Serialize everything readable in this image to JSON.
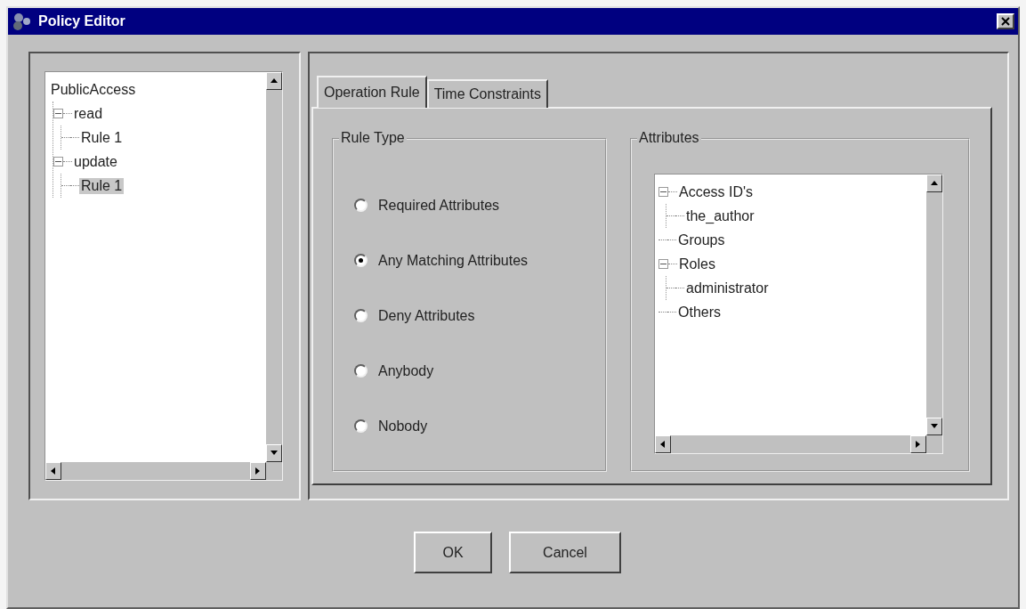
{
  "window": {
    "title": "Policy Editor"
  },
  "policy_tree": [
    {
      "label": "PublicAccess",
      "selected": false,
      "children": [
        {
          "label": "read",
          "selected": false,
          "children": [
            {
              "label": "Rule 1",
              "selected": false
            }
          ]
        },
        {
          "label": "update",
          "selected": false,
          "children": [
            {
              "label": "Rule 1",
              "selected": true
            }
          ]
        }
      ]
    }
  ],
  "tabs": [
    {
      "label": "Operation Rule",
      "selected": true
    },
    {
      "label": "Time Constraints",
      "selected": false
    }
  ],
  "rule_type": {
    "title": "Rule Type",
    "options": [
      {
        "label": "Required Attributes",
        "selected": false
      },
      {
        "label": "Any Matching Attributes",
        "selected": true
      },
      {
        "label": "Deny Attributes",
        "selected": false
      },
      {
        "label": "Anybody",
        "selected": false
      },
      {
        "label": "Nobody",
        "selected": false
      }
    ]
  },
  "attributes": {
    "title": "Attributes",
    "tree": [
      {
        "label": "Access ID's",
        "selected": false,
        "children": [
          {
            "label": "the_author",
            "selected": false
          }
        ]
      },
      {
        "label": "Groups",
        "selected": false
      },
      {
        "label": "Roles",
        "selected": false,
        "children": [
          {
            "label": "administrator",
            "selected": false
          }
        ]
      },
      {
        "label": "Others",
        "selected": false
      }
    ]
  },
  "buttons": [
    {
      "label": "OK"
    },
    {
      "label": "Cancel"
    }
  ]
}
